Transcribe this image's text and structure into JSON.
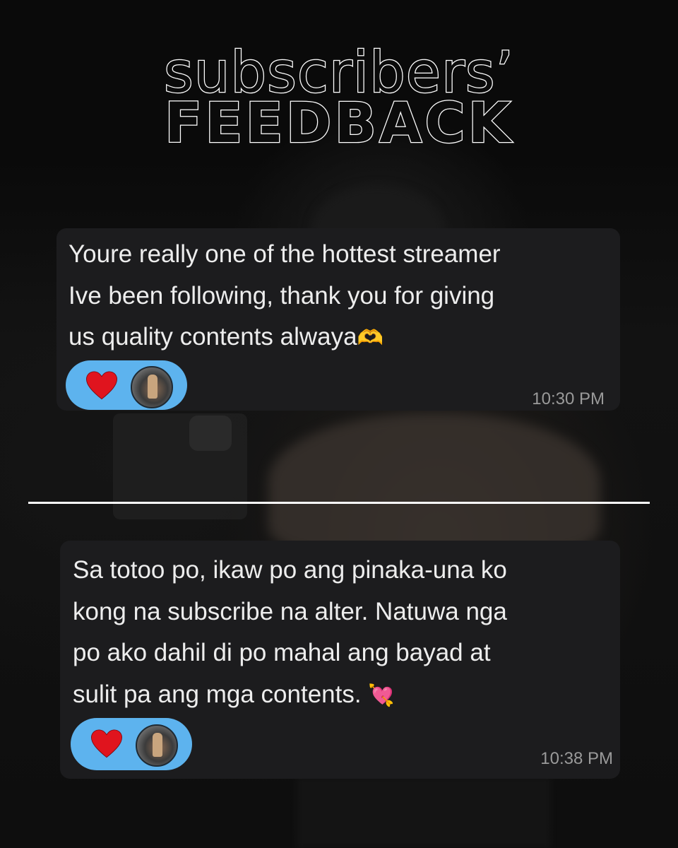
{
  "header": {
    "title_line1": "subscribers’",
    "title_line2": "FEEDBACK"
  },
  "messages": [
    {
      "text": "Youre really one of the hottest streamer\nIve been following, thank you for giving\nus quality contents alwaya",
      "emoji": "🫶",
      "reaction_emoji": "heart-icon",
      "timestamp": "10:30 PM"
    },
    {
      "text": "Sa totoo po, ikaw po ang pinaka-una ko\nkong na subscribe na alter. Natuwa nga\npo ako dahil di po mahal ang bayad at\nsulit pa ang mga contents. ",
      "emoji": "💘",
      "reaction_emoji": "heart-icon",
      "timestamp": "10:38 PM"
    }
  ],
  "colors": {
    "background": "#0b0b0b",
    "bubble": "#1c1c1e",
    "reaction_pill": "#5db3ee",
    "heart": "#e0141e",
    "timestamp": "#9a9a9a",
    "divider": "#ffffff"
  }
}
